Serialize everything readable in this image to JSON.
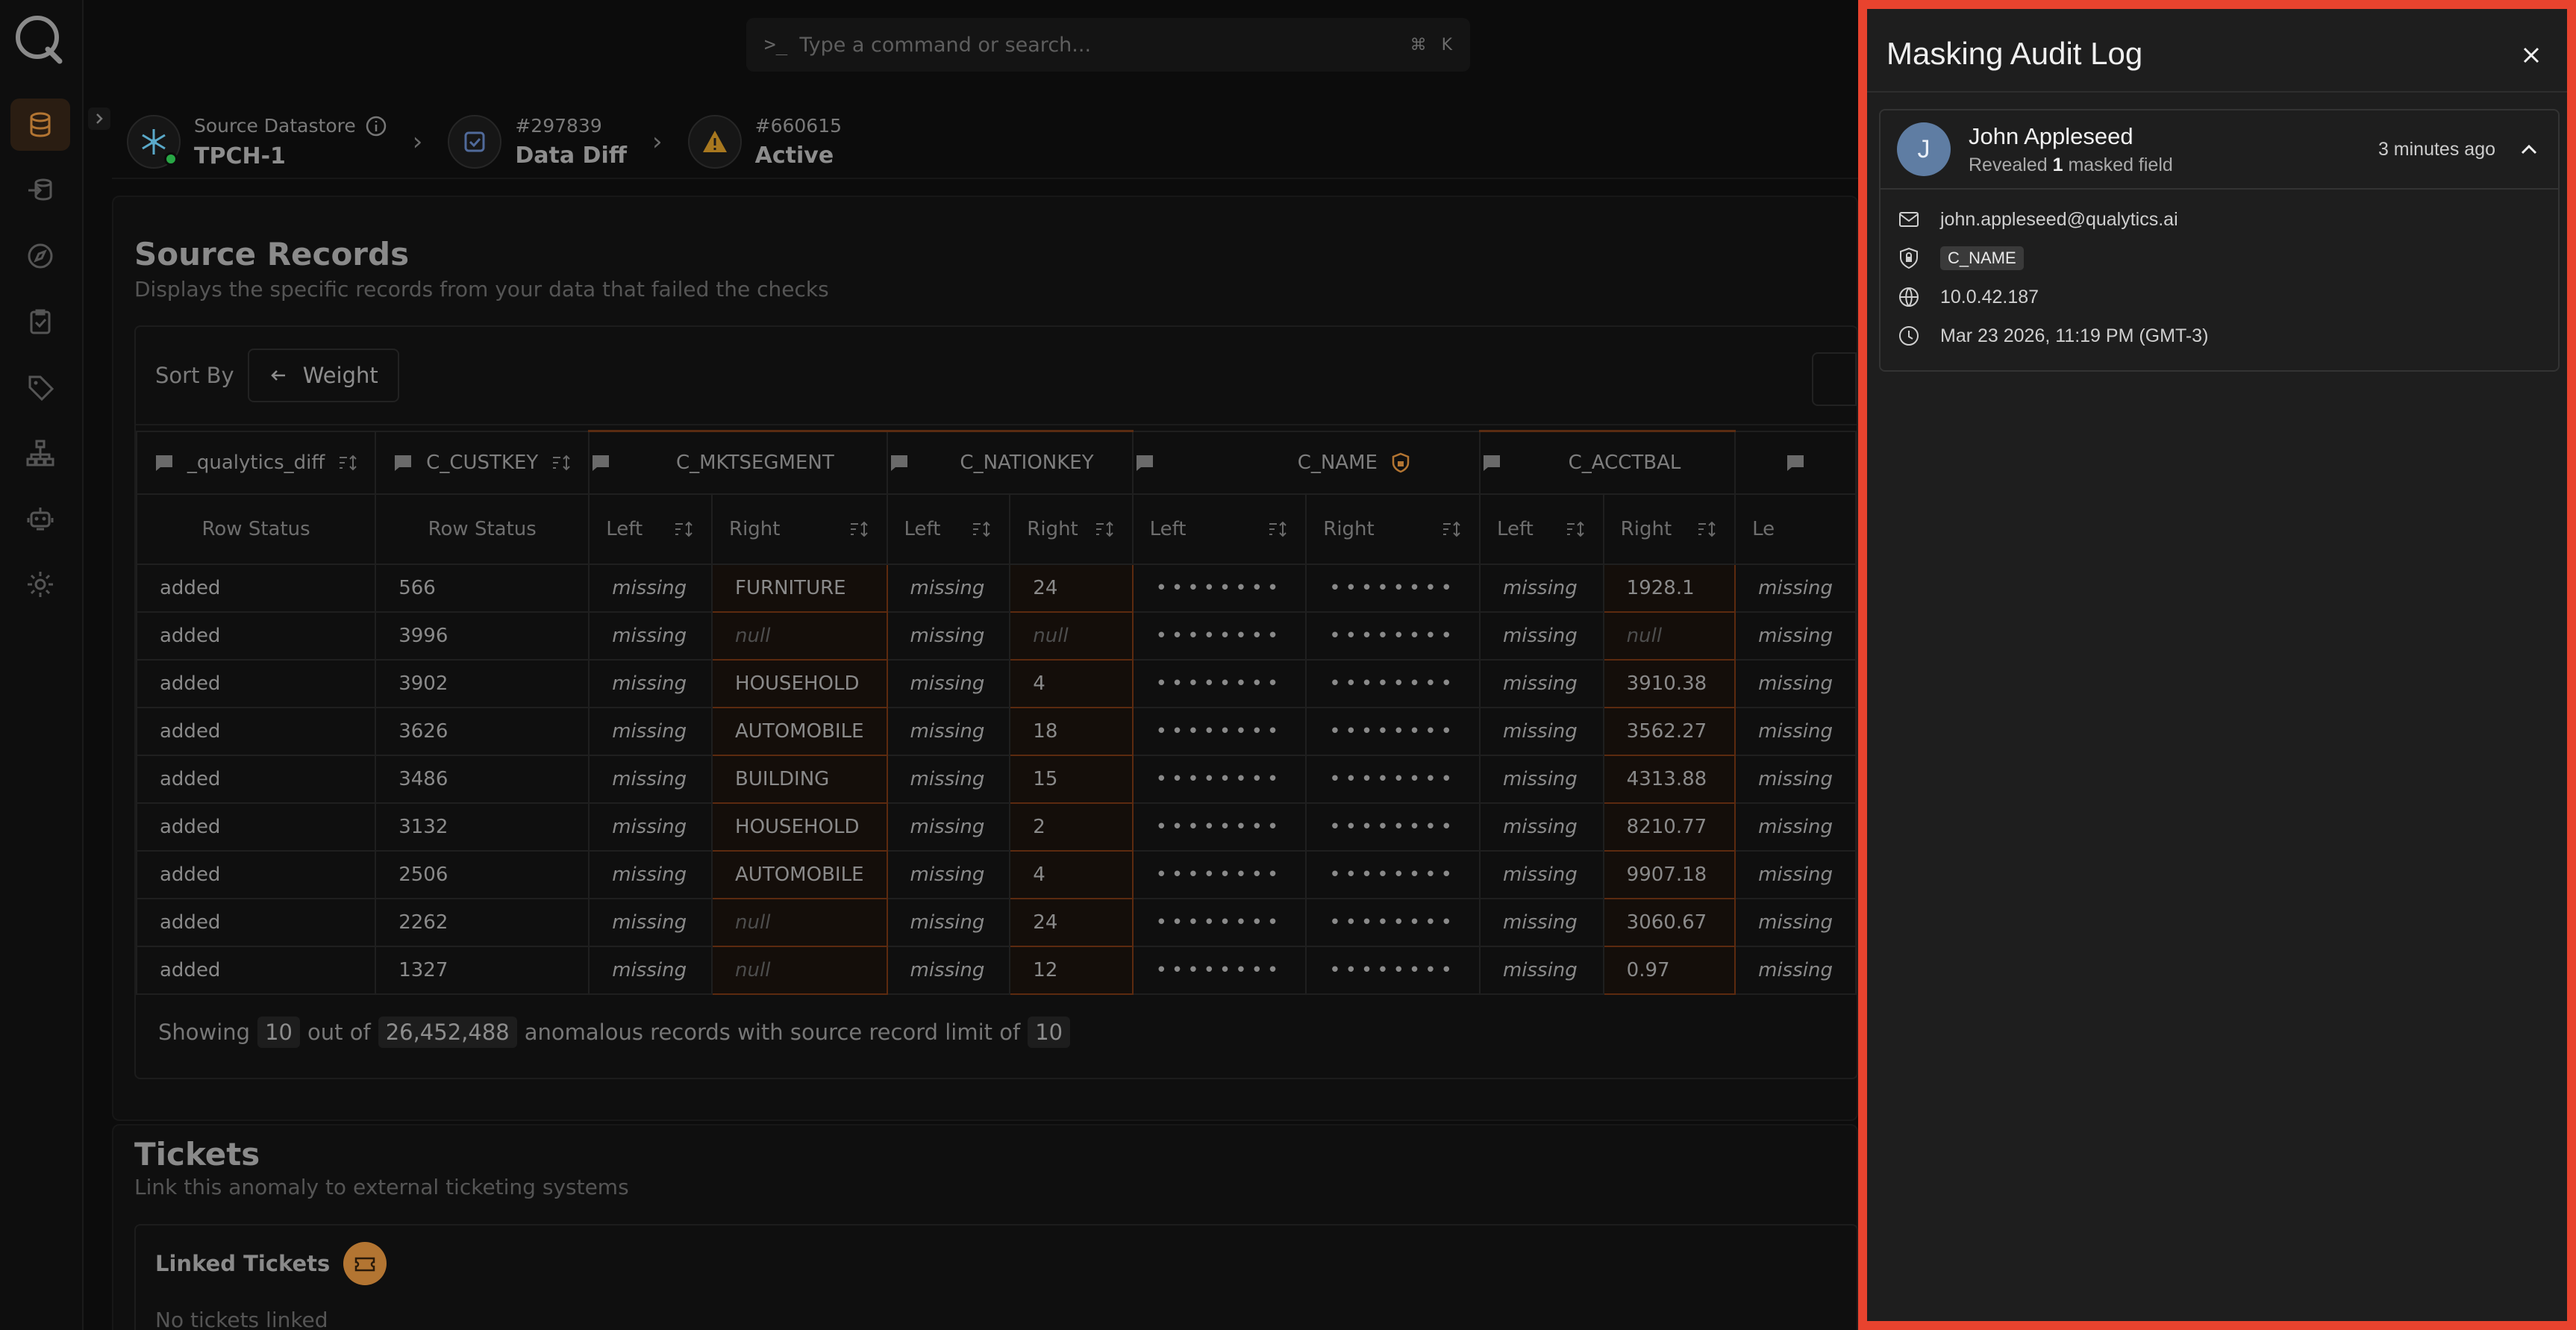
{
  "command": {
    "placeholder": "Type a command or search...",
    "shortcut_mod": "⌘",
    "shortcut_key": "K"
  },
  "breadcrumb": [
    {
      "sub": "Source Datastore",
      "main": "TPCH-1"
    },
    {
      "sub": "#297839",
      "main": "Data Diff"
    },
    {
      "sub": "#660615",
      "main": "Active"
    }
  ],
  "source_records": {
    "title": "Source Records",
    "subtitle": "Displays the specific records from your data that failed the checks",
    "sort_label": "Sort By",
    "sort_value": "Weight",
    "columns": [
      {
        "name": "_qualytics_diff"
      },
      {
        "name": "C_CUSTKEY"
      },
      {
        "name": "C_MKTSEGMENT"
      },
      {
        "name": "C_NATIONKEY"
      },
      {
        "name": "C_NAME"
      },
      {
        "name": "C_ACCTBAL"
      }
    ],
    "sub_headers": {
      "row_status": "Row Status",
      "left": "Left",
      "right": "Right",
      "truncated": "Le"
    },
    "missing_text": "missing",
    "masked_text": "••••••••",
    "rows": [
      {
        "status": "added",
        "key": "566",
        "mkt": "FURNITURE",
        "nation": "24",
        "acct": "1928.1"
      },
      {
        "status": "added",
        "key": "3996",
        "mkt": "null",
        "nation": "null",
        "acct": "null"
      },
      {
        "status": "added",
        "key": "3902",
        "mkt": "HOUSEHOLD",
        "nation": "4",
        "acct": "3910.38"
      },
      {
        "status": "added",
        "key": "3626",
        "mkt": "AUTOMOBILE",
        "nation": "18",
        "acct": "3562.27"
      },
      {
        "status": "added",
        "key": "3486",
        "mkt": "BUILDING",
        "nation": "15",
        "acct": "4313.88"
      },
      {
        "status": "added",
        "key": "3132",
        "mkt": "HOUSEHOLD",
        "nation": "2",
        "acct": "8210.77"
      },
      {
        "status": "added",
        "key": "2506",
        "mkt": "AUTOMOBILE",
        "nation": "4",
        "acct": "9907.18"
      },
      {
        "status": "added",
        "key": "2262",
        "mkt": "null",
        "nation": "24",
        "acct": "3060.67"
      },
      {
        "status": "added",
        "key": "1327",
        "mkt": "null",
        "nation": "12",
        "acct": "0.97"
      }
    ],
    "footer": {
      "showing": "Showing",
      "count": "10",
      "out_of": "out of",
      "total": "26,452,488",
      "middle": "anomalous records with source record limit of",
      "limit": "10"
    }
  },
  "tickets": {
    "title": "Tickets",
    "subtitle": "Link this anomaly to external ticketing systems",
    "linked_label": "Linked Tickets",
    "empty": "No tickets linked"
  },
  "drawer": {
    "title": "Masking Audit Log",
    "entry": {
      "avatar_initial": "J",
      "name": "John Appleseed",
      "action_prefix": "Revealed",
      "action_count": "1",
      "action_suffix": "masked field",
      "time": "3 minutes ago",
      "email": "john.appleseed@qualytics.ai",
      "field": "C_NAME",
      "ip": "10.0.42.187",
      "timestamp": "Mar 23 2026, 11:19 PM (GMT-3)"
    }
  },
  "colors": {
    "accent": "#b37532",
    "drawer_border": "#e8432e",
    "avatar": "#5f7da3",
    "highlight_border": "#5c2a0f"
  }
}
